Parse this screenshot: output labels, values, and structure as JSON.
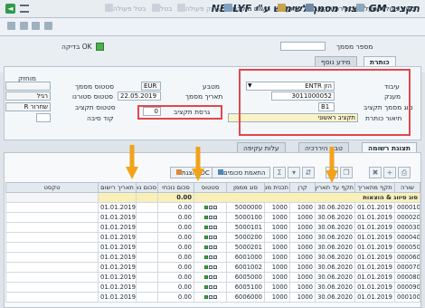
{
  "window": {
    "title": "תקציב GM - צור מסמך לשימוש ע\"י NELLYF"
  },
  "toolbar": {
    "items": [
      {
        "label": "סגור פעולות מעל",
        "enabled": true
      },
      {
        "label": "סקירת תקציב",
        "enabled": true
      },
      {
        "label": "החזק",
        "enabled": true
      },
      {
        "label": "רישום מוקדם",
        "enabled": true
      },
      {
        "label": "בדוק פעולה",
        "enabled": false
      },
      {
        "label": "בטל",
        "enabled": false
      },
      {
        "label": "בטל פעולה",
        "enabled": false
      }
    ]
  },
  "header": {
    "doc_number_label": "מספר מסמך",
    "doc_number_value": "",
    "check_ok_label": "בדיקה OK"
  },
  "tabs_top": [
    {
      "label": "כותרת",
      "active": true
    },
    {
      "label": "מידע נוסף",
      "active": false
    }
  ],
  "form": {
    "process_label": "עיבוד",
    "process_value": "ENTR הזן",
    "grant_label": "מענק",
    "grant_value": "3011000052",
    "budget_doc_type_label": "סוג מסמך תקציב",
    "budget_doc_type_value": "B1",
    "header_desc_label": "תיאור כותרת",
    "header_desc_value": "תקציב ראשוני",
    "currency_label": "מטבע",
    "currency_value": "EUR",
    "doc_date_label": "תאריך מסמך",
    "doc_date_value": "22.05.2019",
    "budget_version_label": "גרסת תקציב",
    "budget_version_value": "0",
    "doc_status_label": "סטטוס מסמך",
    "doc_status_value": "",
    "workflow_status_label": "סטטוס סטורנו",
    "workflow_status_value": "רגיל",
    "budget_status_label": "סטטוס תקציב",
    "budget_status_value": "R שחרור",
    "reason_code_label": "קוד סיבה",
    "reason_code_value": "",
    "holder_label": "מוחזק",
    "holder_value": ""
  },
  "tabs_bottom": [
    {
      "label": "תצוגת רשומה",
      "active": true
    },
    {
      "label": "טבע היררכיה",
      "active": false
    },
    {
      "label": "עלות עקיפה",
      "active": false
    }
  ],
  "grid_toolbar": {
    "adjust_label": "התאמת סכומים",
    "idc_label": "הצגת IDC",
    "sigma_symbol": "Σ"
  },
  "grid": {
    "columns": [
      "שורה",
      "תקף מתאריך",
      "תקף עד תאריך",
      "קרן",
      "תכנית ממומנת",
      "סוג מממן",
      "סטטוס",
      "סכום נוכחי",
      "סכום נוכ",
      "תאריך רישום",
      "טקסט"
    ],
    "summary_label": "סוג סיווג & הוצאות",
    "summary_total": "0.00",
    "rows": [
      {
        "line": "000010",
        "from": "01.01.2019",
        "to": "30.06.2020",
        "fund": "1000",
        "program": "1000",
        "class": "5000000",
        "amount": "0.00",
        "date": "01.01.2019"
      },
      {
        "line": "000020",
        "from": "01.01.2019",
        "to": "30.06.2020",
        "fund": "1000",
        "program": "1000",
        "class": "5000100",
        "amount": "0.00",
        "date": "01.01.2019"
      },
      {
        "line": "000030",
        "from": "01.01.2019",
        "to": "30.06.2020",
        "fund": "1000",
        "program": "1000",
        "class": "5000101",
        "amount": "0.00",
        "date": "01.01.2019"
      },
      {
        "line": "000040",
        "from": "01.01.2019",
        "to": "30.06.2020",
        "fund": "1000",
        "program": "1000",
        "class": "5000200",
        "amount": "0.00",
        "date": "01.01.2019"
      },
      {
        "line": "000050",
        "from": "01.01.2019",
        "to": "30.06.2020",
        "fund": "1000",
        "program": "1000",
        "class": "5000201",
        "amount": "0.00",
        "date": "01.01.2019"
      },
      {
        "line": "000060",
        "from": "01.01.2019",
        "to": "30.06.2020",
        "fund": "1000",
        "program": "1000",
        "class": "6001000",
        "amount": "0.00",
        "date": "01.01.2019"
      },
      {
        "line": "000070",
        "from": "01.01.2019",
        "to": "30.06.2020",
        "fund": "1000",
        "program": "1000",
        "class": "6001002",
        "amount": "0.00",
        "date": "01.01.2019"
      },
      {
        "line": "000080",
        "from": "01.01.2019",
        "to": "30.06.2020",
        "fund": "1000",
        "program": "1000",
        "class": "6005000",
        "amount": "0.00",
        "date": "01.01.2019"
      },
      {
        "line": "000090",
        "from": "01.01.2019",
        "to": "30.06.2020",
        "fund": "1000",
        "program": "1000",
        "class": "6005100",
        "amount": "0.00",
        "date": "01.01.2019"
      },
      {
        "line": "000100",
        "from": "01.01.2019",
        "to": "30.06.2020",
        "fund": "1000",
        "program": "1000",
        "class": "6006000",
        "amount": "0.00",
        "date": "01.01.2019"
      }
    ]
  },
  "colors": {
    "highlight_box": "#e0474c",
    "arrow": "#f2a31b",
    "summary_row": "#f9efb9",
    "status_green": "#43a047"
  }
}
